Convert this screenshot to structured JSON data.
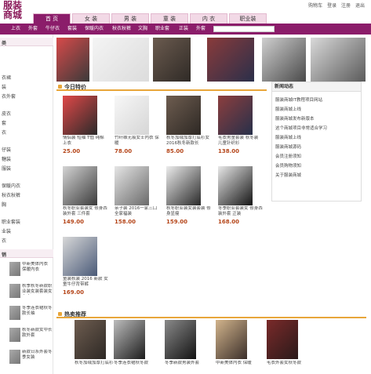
{
  "header": {
    "logo_line1": "服装",
    "logo_line2": "商城"
  },
  "toplinks": [
    "购物车",
    "登录",
    "注册",
    "退出"
  ],
  "tabs": [
    "首 页",
    "女 装",
    "男 装",
    "童 装",
    "内 衣",
    "职业装"
  ],
  "nav": [
    "上衣",
    "外套",
    "牛仔衣",
    "套装",
    "保暖内衣",
    "秋衣秋裤",
    "文胸",
    "职业套",
    "正装",
    "外套"
  ],
  "search": {
    "button": "搜索",
    "placeholder": ""
  },
  "sidebar": {
    "items": [
      "类",
      "",
      "衣裙",
      "装",
      "衣外套",
      "",
      "皮衣",
      "套",
      "衣",
      "",
      "仔装",
      "糖装",
      "服装",
      "",
      "保暖内衣",
      "秋衣秋裤",
      "胸",
      "",
      "职业套装",
      "业装",
      "衣"
    ],
    "section2": "销",
    "hot": [
      "中新美体内衣 保暖内衣",
      "秋季秋冬新款职业装女装套装女上衣",
      "冬季连衣裙秋冬款长袖",
      "秋冬新款女中长款外套",
      "新款日系外套冬季女装"
    ]
  },
  "sections": {
    "today": "今日特价",
    "hot": "热卖推荐"
  },
  "news": {
    "title": "新闻动态",
    "items": [
      "服装商城IT教程项目网站",
      "服装商城上线",
      "服装商城发布新版本",
      "这个商城项目非常适合学习",
      "服装商城上线",
      "服装商城源码",
      "会员注册须知",
      "会员购物须知",
      "关于服装商城"
    ]
  },
  "today_products": [
    {
      "name": "情侣装 短袖 T恤 纯棉上衣",
      "price": "25.00"
    },
    {
      "name": "竹纤维无痕女士内衣 保暖",
      "price": "78.00"
    },
    {
      "name": "秋冬加绒加厚打底衫女 2016秋冬新款长",
      "price": "85.00"
    },
    {
      "name": "毛衣男童套装 秋冬装 儿童针织衫",
      "price": "138.00"
    },
    {
      "name": "秋冬职业套装女 修身西装外套 三件套",
      "price": "149.00"
    },
    {
      "name": "亲子装 2016一家三口全家福装",
      "price": "158.00"
    },
    {
      "name": "秋冬职业装女装套装 修身显瘦",
      "price": "159.00"
    },
    {
      "name": "冬季职业套装女 修身西装外套 正装",
      "price": "168.00"
    },
    {
      "name": "童装秋装 2016 新款 女童牛仔背带裤",
      "price": "169.00"
    }
  ],
  "hot_products": [
    {
      "name": "秋冬加绒加厚打底衫"
    },
    {
      "name": "冬季连衣裙秋冬款"
    },
    {
      "name": "冬季新款男装外套"
    },
    {
      "name": "中新美体内衣 保暖"
    },
    {
      "name": "毛衣外套女秋冬款"
    }
  ]
}
